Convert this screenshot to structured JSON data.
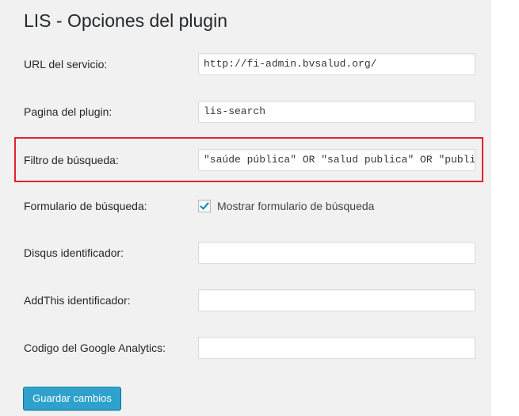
{
  "page": {
    "title": "LIS - Opciones del plugin"
  },
  "fields": {
    "service_url": {
      "label": "URL del servicio:",
      "value": "http://fi-admin.bvsalud.org/"
    },
    "plugin_page": {
      "label": "Pagina del plugin:",
      "value": "lis-search"
    },
    "search_filter": {
      "label": "Filtro de búsqueda:",
      "value": "\"saúde pública\" OR \"salud publica\" OR \"public health\""
    },
    "search_form": {
      "label": "Formulario de búsqueda:",
      "checkbox_label": "Mostrar formulario de búsqueda",
      "checked": true
    },
    "disqus_id": {
      "label": "Disqus identificador:",
      "value": ""
    },
    "addthis_id": {
      "label": "AddThis identificador:",
      "value": ""
    },
    "google_analytics": {
      "label": "Codigo del Google Analytics:",
      "value": ""
    }
  },
  "actions": {
    "save_label": "Guardar cambios"
  },
  "colors": {
    "primary_button": "#2ea2cc",
    "highlight_border": "#e0232a",
    "checkmark": "#1e8cbe"
  },
  "icons": {
    "checkbox_mark": "checkmark-icon"
  }
}
